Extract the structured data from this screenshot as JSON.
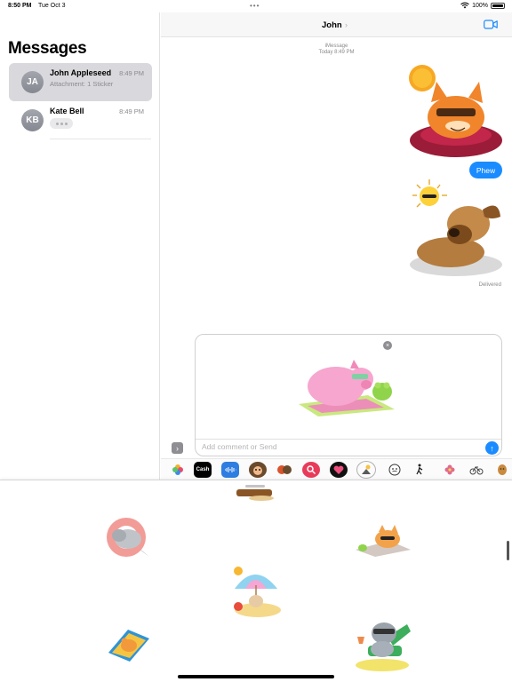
{
  "status_bar": {
    "time": "8:50 PM",
    "date": "Tue Oct 3",
    "dots": "•••",
    "battery": "100%",
    "icons": [
      "wifi-icon",
      "battery-icon"
    ]
  },
  "sidebar": {
    "title": "Messages",
    "conversations": [
      {
        "initials": "JA",
        "name": "John Appleseed",
        "time": "8:49 PM",
        "preview": "Attachment: 1 Sticker"
      },
      {
        "initials": "KB",
        "name": "Kate Bell",
        "time": "8:49 PM",
        "preview": ""
      }
    ]
  },
  "conversation": {
    "title": "John",
    "chevron": "›",
    "service": "iMessage",
    "timestamp": "Today 8:49 PM",
    "bubble_text": "Phew",
    "status": "Delivered",
    "stickers": [
      "sun-cat-sticker",
      "sun-dog-sticker"
    ]
  },
  "compose": {
    "placeholder": "Add comment or Send",
    "remove_glyph": "×",
    "send_glyph": "↑",
    "expand_glyph": "›",
    "attachment": "pig-frog-sticker"
  },
  "apps": [
    {
      "name": "photos-app-icon"
    },
    {
      "name": "cash-app-icon",
      "label": "Cash"
    },
    {
      "name": "audio-app-icon"
    },
    {
      "name": "memoji-app-icon"
    },
    {
      "name": "memoji-stickers-app-icon"
    },
    {
      "name": "search-images-app-icon"
    },
    {
      "name": "digital-touch-app-icon"
    },
    {
      "name": "sticker-pack-app-icon"
    },
    {
      "name": "emoji-face-app-icon"
    },
    {
      "name": "walk-app-icon"
    },
    {
      "name": "flower-app-icon"
    },
    {
      "name": "bike-app-icon"
    },
    {
      "name": "potato-app-icon"
    }
  ],
  "drawer_stickers": [
    "seal-float-sticker",
    "fox-sunbathing-sticker",
    "umbrella-beach-sticker",
    "bear-towel-sticker",
    "raccoon-chair-sticker",
    "log-sticker"
  ],
  "colors": {
    "accent": "#1a8cff",
    "selected_row": "#d9d9dd"
  }
}
